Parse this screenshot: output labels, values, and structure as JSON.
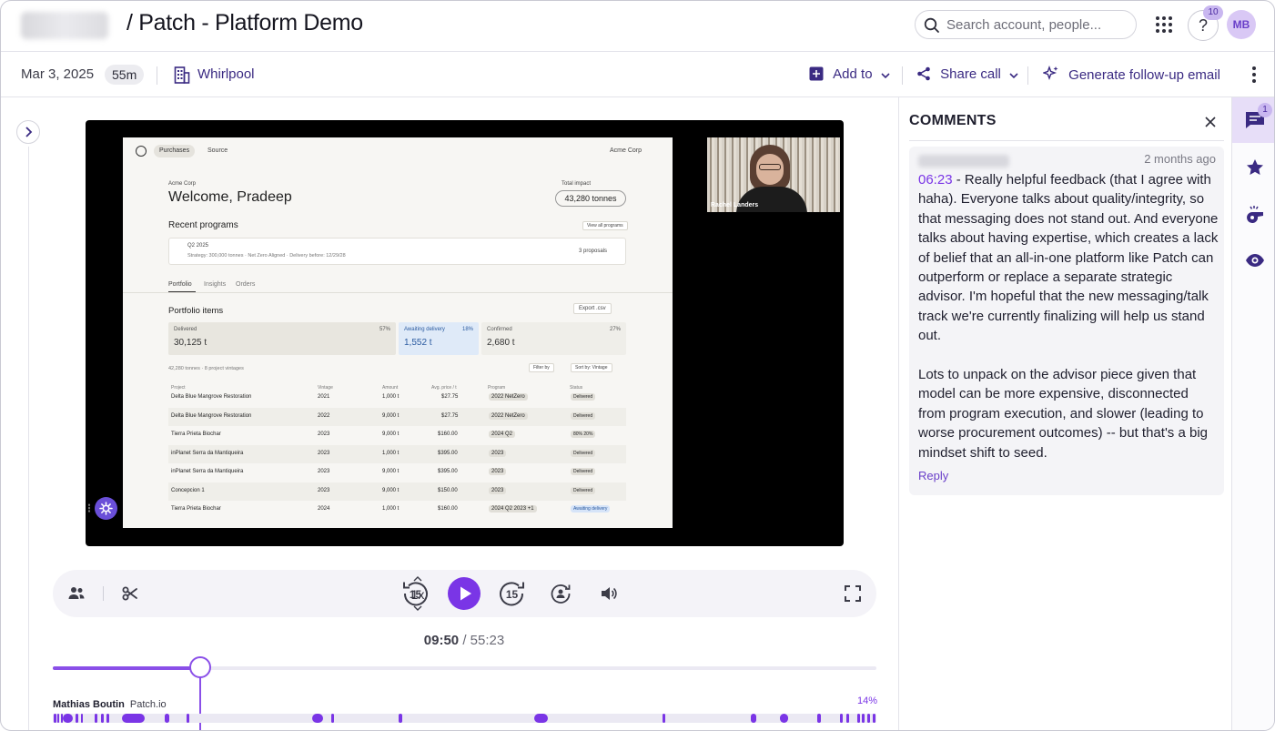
{
  "header": {
    "title": "/ Patch - Platform Demo",
    "search_placeholder": "Search account, people...",
    "help_label": "?",
    "notifications_count": "10",
    "avatar_initials": "MB"
  },
  "call_info": {
    "date": "Mar 3, 2025",
    "duration": "55m",
    "company": "Whirlpool",
    "add_to_label": "Add to",
    "share_label": "Share call",
    "followup_label": "Generate follow-up email"
  },
  "video": {
    "screen": {
      "tab_purchases": "Purchases",
      "tab_source": "Source",
      "account": "Acme Corp",
      "company": "Acme Corp",
      "welcome": "Welcome, Pradeep",
      "total_impact_label": "Total impact",
      "total_impact_value": "43,280 tonnes",
      "recent_programs": "Recent programs",
      "view_all": "View all programs",
      "program_name": "Q2 2025",
      "program_details": "Strategy: 300,000 tonnes  ·  Net Zero Aligned  ·  Delivery before: 12/29/28",
      "program_proposals": "3 proposals",
      "tabs": [
        "Portfolio",
        "Insights",
        "Orders"
      ],
      "portfolio_items": "Portfolio items",
      "export": "Export .csv",
      "stats": [
        {
          "label": "Delivered",
          "pct": "57%",
          "value": "30,125 t"
        },
        {
          "label": "Awaiting delivery",
          "pct": "18%",
          "value": "1,552 t"
        },
        {
          "label": "Confirmed",
          "pct": "27%",
          "value": "2,680 t"
        }
      ],
      "summary": "42,280 tonnes  ·  8 project vintages",
      "filter": "Filter by",
      "sort": "Sort by: Vintage",
      "columns": [
        "Project",
        "Vintage",
        "Amount",
        "Avg. price / t",
        "Program",
        "Status"
      ],
      "rows": [
        {
          "project": "Delta Blue Mangrove Restoration",
          "vintage": "2021",
          "amount": "1,000 t",
          "price": "$27.75",
          "program": "2022 NetZero",
          "status": "Delivered"
        },
        {
          "project": "Delta Blue Mangrove Restoration",
          "vintage": "2022",
          "amount": "9,000 t",
          "price": "$27.75",
          "program": "2022 NetZero",
          "status": "Delivered"
        },
        {
          "project": "Tierra Prieta Biochar",
          "vintage": "2023",
          "amount": "9,000 t",
          "price": "$160.00",
          "program": "2024 Q2",
          "status": "80%  20%"
        },
        {
          "project": "inPlanet Serra da Mantiqueira",
          "vintage": "2023",
          "amount": "1,000 t",
          "price": "$395.00",
          "program": "2023",
          "status": "Delivered"
        },
        {
          "project": "inPlanet Serra da Mantiqueira",
          "vintage": "2023",
          "amount": "9,000 t",
          "price": "$395.00",
          "program": "2023",
          "status": "Delivered"
        },
        {
          "project": "Concepcion 1",
          "vintage": "2023",
          "amount": "9,000 t",
          "price": "$150.00",
          "program": "2023",
          "status": "Delivered"
        },
        {
          "project": "Tierra Prieta Biochar",
          "vintage": "2024",
          "amount": "1,000 t",
          "price": "$160.00",
          "program": "2024 Q2  2023  +1",
          "status": "Awaiting delivery"
        }
      ]
    },
    "participant_name": "Rachel Landers"
  },
  "player": {
    "speed": "1x",
    "skip_back": "15",
    "skip_forward": "15",
    "current_time": "09:50",
    "total_time": "55:23",
    "progress": 0.178,
    "time_separator": " / "
  },
  "timeline": {
    "speaker_name": "Mathias Boutin",
    "speaker_org": "Patch.io",
    "talk_pct": "14%"
  },
  "comments": {
    "title": "COMMENTS",
    "items": [
      {
        "when": "2 months ago",
        "timestamp": "06:23",
        "text1": " - Really helpful feedback (that I agree with haha). Everyone talks about quality/integrity, so that messaging does not stand out. And everyone talks about having expertise, which creates a lack of belief that an all-in-one platform like Patch can outperform or replace a separate strategic advisor. I'm hopeful that the new messaging/talk track we're currently finalizing will help us stand out.",
        "text2": "Lots to unpack on the advisor piece given that model can be more expensive, disconnected from program execution, and slower (leading to worse procurement outcomes) -- but that's a big mindset shift to seed.",
        "reply_label": "Reply"
      }
    ]
  },
  "right_rail": {
    "comments_count": "1",
    "icons": [
      "comments-icon",
      "star-icon",
      "whistle-icon",
      "eye-icon"
    ]
  },
  "colors": {
    "accent": "#7a35e6",
    "brand_text": "#3a2a82"
  }
}
